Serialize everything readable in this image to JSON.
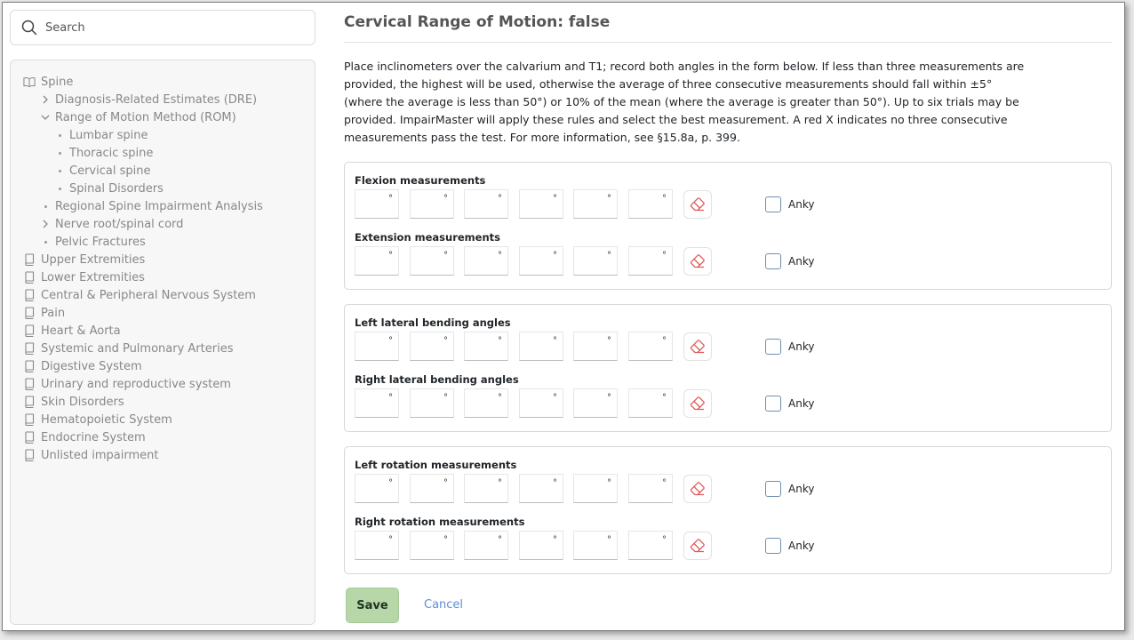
{
  "search": {
    "placeholder": "Search"
  },
  "nav": {
    "items": [
      {
        "label": "Spine",
        "icon": "book-open-icon",
        "level": 0
      },
      {
        "label": "Diagnosis-Related Estimates (DRE)",
        "icon": "chevron-right-icon",
        "level": 1
      },
      {
        "label": "Range of Motion Method (ROM)",
        "icon": "chevron-down-icon",
        "level": 1
      },
      {
        "label": "Lumbar spine",
        "icon": "bullet-icon",
        "level": 2
      },
      {
        "label": "Thoracic spine",
        "icon": "bullet-icon",
        "level": 2
      },
      {
        "label": "Cervical spine",
        "icon": "bullet-icon",
        "level": 2
      },
      {
        "label": "Spinal Disorders",
        "icon": "bullet-icon",
        "level": 2
      },
      {
        "label": "Regional Spine Impairment Analysis",
        "icon": "bullet-icon",
        "level": 1
      },
      {
        "label": "Nerve root/spinal cord",
        "icon": "chevron-right-icon",
        "level": 1
      },
      {
        "label": "Pelvic Fractures",
        "icon": "bullet-icon",
        "level": 1
      },
      {
        "label": "Upper Extremities",
        "icon": "book-icon",
        "level": 0
      },
      {
        "label": "Lower Extremities",
        "icon": "book-icon",
        "level": 0
      },
      {
        "label": "Central & Peripheral Nervous System",
        "icon": "book-icon",
        "level": 0
      },
      {
        "label": "Pain",
        "icon": "book-icon",
        "level": 0
      },
      {
        "label": "Heart & Aorta",
        "icon": "book-icon",
        "level": 0
      },
      {
        "label": "Systemic and Pulmonary Arteries",
        "icon": "book-icon",
        "level": 0
      },
      {
        "label": "Digestive System",
        "icon": "book-icon",
        "level": 0
      },
      {
        "label": "Urinary and reproductive system",
        "icon": "book-icon",
        "level": 0
      },
      {
        "label": "Skin Disorders",
        "icon": "book-icon",
        "level": 0
      },
      {
        "label": "Hematopoietic System",
        "icon": "book-icon",
        "level": 0
      },
      {
        "label": "Endocrine System",
        "icon": "book-icon",
        "level": 0
      },
      {
        "label": "Unlisted impairment",
        "icon": "book-icon",
        "level": 0
      }
    ]
  },
  "main": {
    "title": "Cervical Range of Motion: false",
    "description": "Place inclinometers over the calvarium and T1; record both angles in the form below. If less than three measurements are provided, the highest will be used, otherwise the average of three consecutive measurements should fall within ±5° (where the average is less than 50°) or 10% of the mean (where the average is greater than 50°). Up to six trials may be provided. ImpairMaster will apply these rules and select the best measurement. A red X indicates no three consecutive measurements pass the test. For more information, see §15.8a, p. 399.",
    "degree_symbol": "°",
    "groups": [
      {
        "rows": [
          {
            "label": "Flexion measurements",
            "anky_label": "Anky",
            "anky_checked": false
          },
          {
            "label": "Extension measurements",
            "anky_label": "Anky",
            "anky_checked": false
          }
        ]
      },
      {
        "rows": [
          {
            "label": "Left lateral bending angles",
            "anky_label": "Anky",
            "anky_checked": false
          },
          {
            "label": "Right lateral bending angles",
            "anky_label": "Anky",
            "anky_checked": false
          }
        ]
      },
      {
        "rows": [
          {
            "label": "Left rotation measurements",
            "anky_label": "Anky",
            "anky_checked": false
          },
          {
            "label": "Right rotation measurements",
            "anky_label": "Anky",
            "anky_checked": false
          }
        ]
      }
    ],
    "save_label": "Save",
    "cancel_label": "Cancel"
  },
  "colors": {
    "save_bg": "#b7d7a8",
    "cancel": "#5b8fd4",
    "eraser": "#e05a5a",
    "checkbox_border": "#6e8fae"
  }
}
